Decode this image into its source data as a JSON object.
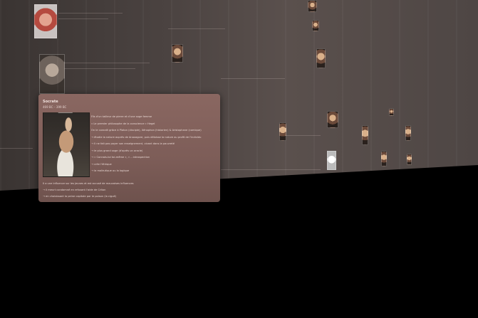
{
  "card": {
    "title": "Socrate",
    "dates": "469 BC – 399 BC",
    "portrait_icon": "socrates-portrait",
    "lines": [
      "Fils d'un tailleur de pierre et d'une sage femme",
      "« Le premier philosophe de la conscience » Hegel",
      "On le connaît grâce à Platon (disciple), Xénophon (historien) & Aristophane (comique)",
      "→ étudie la nature auprès de Anaxagore, puis délaisse la nature au profit de l'individu",
      "→ Il ne fait pas payer son enseignement, vivant dans la pauvreté",
      "→ le plus grand sage (d'après un oracle)",
      "→ « Connais-toi toi-même », « ...introspection",
      "→ crée l'éthique",
      "→ la maïeutique ou la logique"
    ],
    "lower_lines": [
      "Il a une influence sur les jeunes et est accusé de mauvaises influences",
      "→ il meurt condamné en refusant l'aide de Criton",
      "→ en choisissant la peine capitale par le poison (la ciguë)"
    ]
  },
  "colors": {
    "card_bg": "#8a6761",
    "card_text": "#f2e2de",
    "wall": "#4b4341"
  }
}
